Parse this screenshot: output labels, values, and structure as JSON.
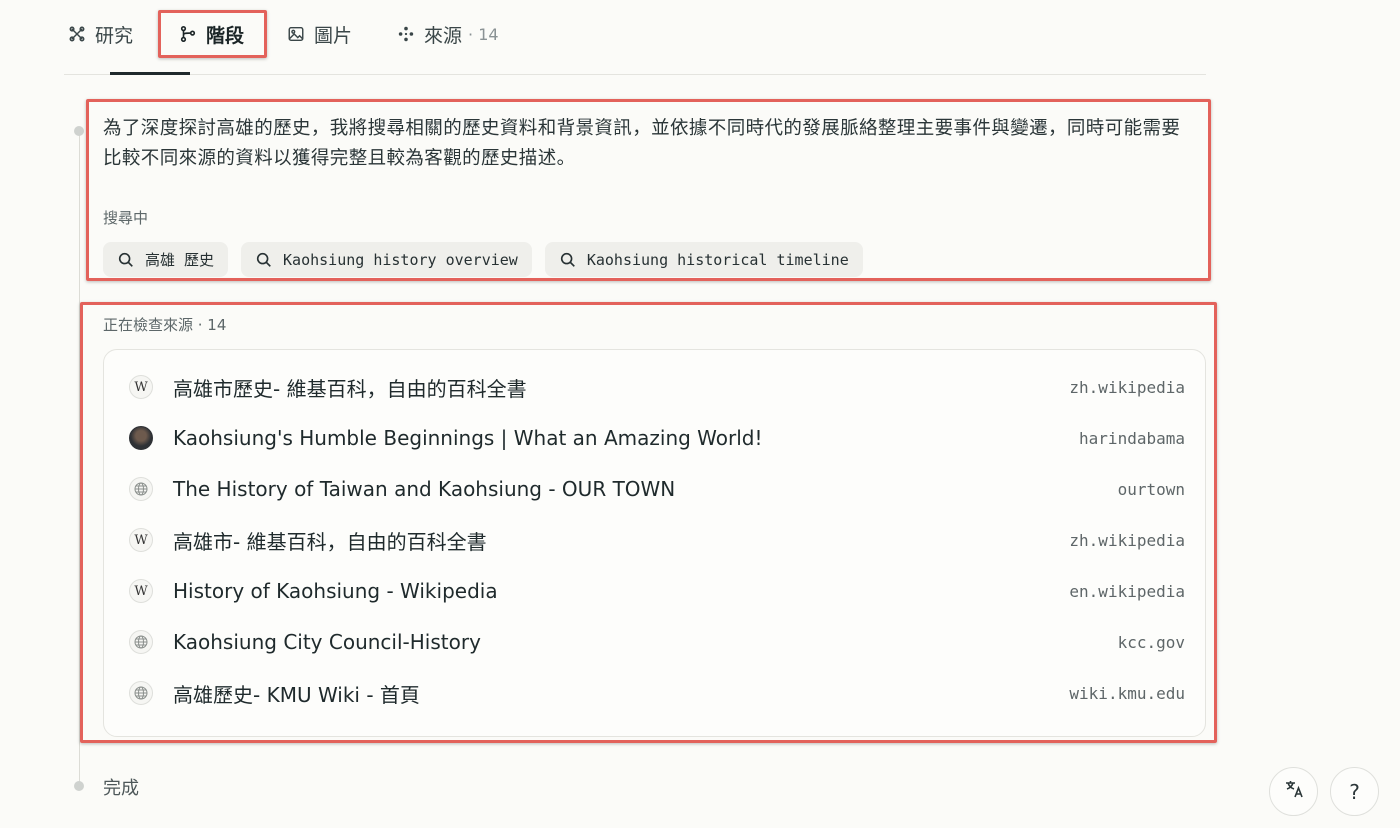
{
  "tabs": [
    {
      "label": "研究",
      "icon": "research-icon"
    },
    {
      "label": "階段",
      "icon": "branch-icon"
    },
    {
      "label": "圖片",
      "icon": "image-icon"
    },
    {
      "label": "來源",
      "icon": "sources-icon",
      "count": "· 14"
    }
  ],
  "step": {
    "text": "為了深度探討高雄的歷史，我將搜尋相關的歷史資料和背景資訊，並依據不同時代的發展脈絡整理主要事件與變遷，同時可能需要比較不同來源的資料以獲得完整且較為客觀的歷史描述。",
    "searching_label": "搜尋中",
    "queries": [
      "高雄 歷史",
      "Kaohsiung history overview",
      "Kaohsiung historical timeline"
    ]
  },
  "sources": {
    "label": "正在檢查來源 · 14",
    "items": [
      {
        "title": "高雄市歷史- 維基百科，自由的百科全書",
        "domain": "zh.wikipedia",
        "icon": "wikipedia-icon"
      },
      {
        "title": "Kaohsiung's Humble Beginnings | What an Amazing World!",
        "domain": "harindabama",
        "icon": "avatar-icon"
      },
      {
        "title": "The History of Taiwan and Kaohsiung - OUR TOWN",
        "domain": "ourtown",
        "icon": "globe-icon"
      },
      {
        "title": "高雄市- 維基百科，自由的百科全書",
        "domain": "zh.wikipedia",
        "icon": "wikipedia-icon"
      },
      {
        "title": "History of Kaohsiung - Wikipedia",
        "domain": "en.wikipedia",
        "icon": "wikipedia-icon"
      },
      {
        "title": "Kaohsiung City Council-History",
        "domain": "kcc.gov",
        "icon": "globe-icon"
      },
      {
        "title": "高雄歷史- KMU Wiki - 首頁",
        "domain": "wiki.kmu.edu",
        "icon": "globe-icon"
      }
    ]
  },
  "done_label": "完成",
  "buttons": {
    "help": "?"
  },
  "colors": {
    "highlight": "#e3625b",
    "text": "#1f2a2c"
  }
}
